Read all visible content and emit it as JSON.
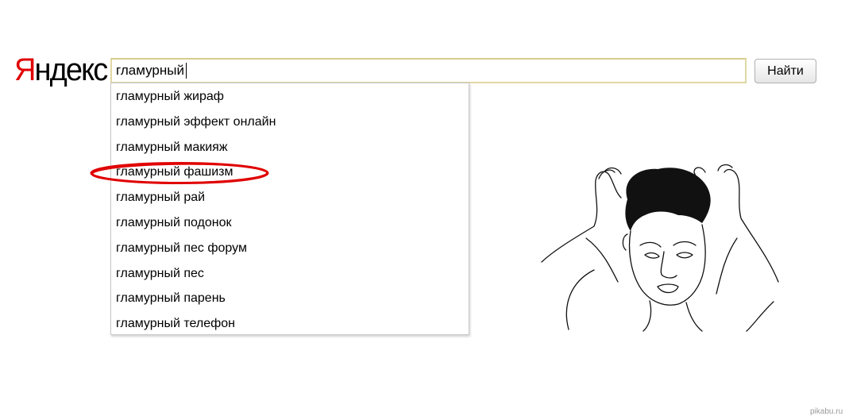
{
  "logo": {
    "first_letter": "Я",
    "rest": "ндекс"
  },
  "search": {
    "value": "гламурный"
  },
  "button": {
    "label": "Найти"
  },
  "suggestions": [
    "гламурный жираф",
    "гламурный эффект онлайн",
    "гламурный макияж",
    "гламурный фашизм",
    "гламурный рай",
    "гламурный подонок",
    "гламурный пес форум",
    "гламурный пес",
    "гламурный парень",
    "гламурный телефон"
  ],
  "highlighted_suggestion_index": 3,
  "colors": {
    "logo_red": "#e00000",
    "highlight_ring": "#e00000",
    "search_border": "#e0d7a4"
  },
  "watermark": "pikabu.ru"
}
